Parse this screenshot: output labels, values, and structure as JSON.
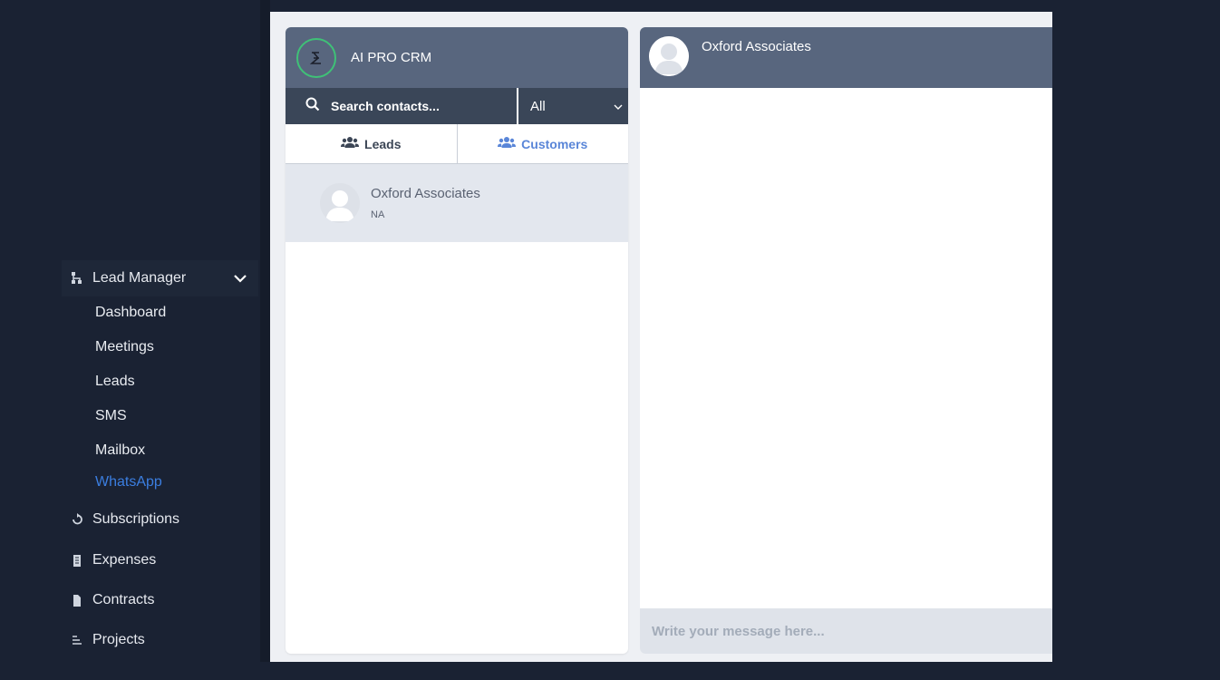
{
  "sidebar": {
    "lead_manager": {
      "label": "Lead Manager",
      "icon": "sitemap-icon",
      "expanded": true
    },
    "sub_items": [
      {
        "label": "Dashboard",
        "active": false
      },
      {
        "label": "Meetings",
        "active": false
      },
      {
        "label": "Leads",
        "active": false
      },
      {
        "label": "SMS",
        "active": false
      },
      {
        "label": "Mailbox",
        "active": false
      },
      {
        "label": "WhatsApp",
        "active": true
      }
    ],
    "main_items": [
      {
        "label": "Subscriptions",
        "icon": "refresh-icon"
      },
      {
        "label": "Expenses",
        "icon": "receipt-icon"
      },
      {
        "label": "Contracts",
        "icon": "file-icon"
      },
      {
        "label": "Projects",
        "icon": "list-icon"
      }
    ]
  },
  "contacts_panel": {
    "brand_name": "AI PRO CRM",
    "search": {
      "placeholder": "Search contacts..."
    },
    "filter": {
      "selected": "All"
    },
    "tabs": [
      {
        "label": "Leads",
        "icon": "users-icon",
        "active": false
      },
      {
        "label": "Customers",
        "icon": "users-icon",
        "active": true
      }
    ],
    "contacts": [
      {
        "name": "Oxford Associates",
        "subtitle": "NA"
      }
    ]
  },
  "chat_panel": {
    "title": "Oxford Associates",
    "input_placeholder": "Write your message here..."
  },
  "colors": {
    "sidebar_bg": "#1a2233",
    "header_bg": "#58667e",
    "accent": "#3b7ee0",
    "logo_ring": "#3fc177"
  }
}
